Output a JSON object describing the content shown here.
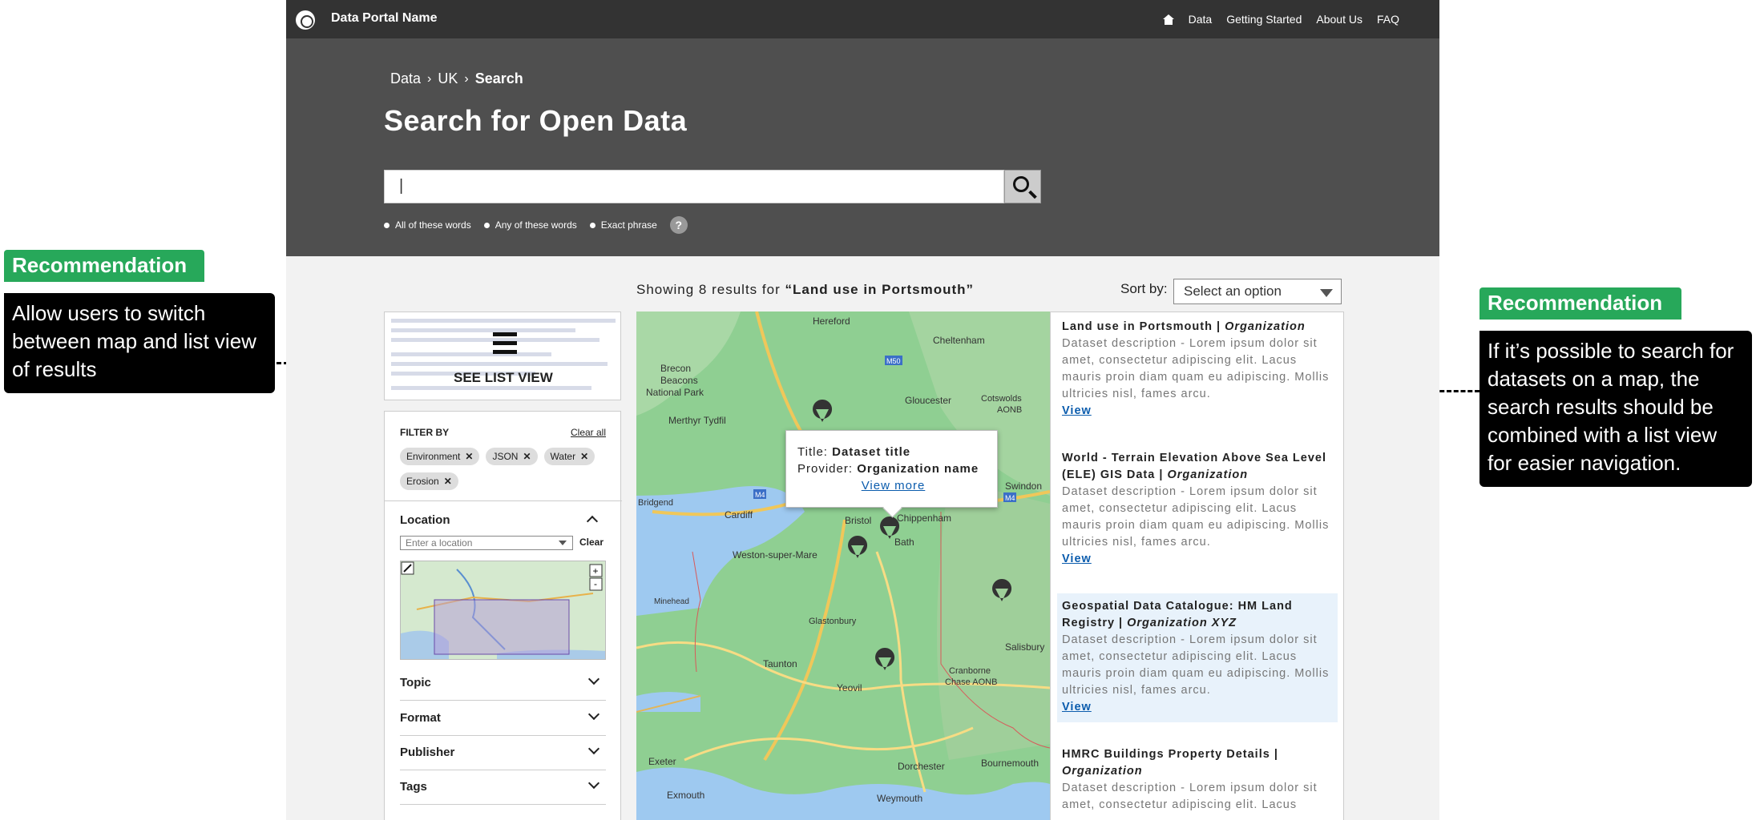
{
  "header": {
    "brand": "Data Portal Name",
    "nav": [
      "Data",
      "Getting Started",
      "About Us",
      "FAQ"
    ]
  },
  "hero": {
    "breadcrumb": [
      "Data",
      "UK",
      "Search"
    ],
    "title": "Search for Open Data",
    "search_value": "|",
    "search_options": [
      "All of these words",
      "Any of these words",
      "Exact phrase"
    ],
    "help": "?"
  },
  "results_header": {
    "prefix": "Showing 8 results for",
    "query": "“Land use in Portsmouth”",
    "sort_label": "Sort by:",
    "sort_value": "Select an option"
  },
  "list_view": {
    "label": "SEE LIST VIEW"
  },
  "filters": {
    "title": "FILTER BY",
    "clear_all": "Clear all",
    "tags": [
      "Environment",
      "JSON",
      "Water",
      "Erosion"
    ],
    "location": {
      "title": "Location",
      "placeholder": "Enter a location",
      "clear": "Clear"
    },
    "facets": [
      "Topic",
      "Format",
      "Publisher",
      "Tags"
    ]
  },
  "map": {
    "places": [
      "Hereford",
      "Brecon Beacons National Park",
      "Merthyr Tydfil",
      "Cheltenham",
      "Gloucester",
      "Cotswolds AONB",
      "Cardiff",
      "Bristol",
      "Bath",
      "Chippenham",
      "Swindon",
      "Weston-super-Mare",
      "Minehead",
      "Glastonbury",
      "Taunton",
      "Yeovil",
      "Salisbury",
      "Cranborne Chase AONB",
      "Exeter",
      "Dorchester",
      "Bournemouth",
      "Weymouth",
      "Exmouth",
      "Bridgend",
      "M50",
      "M4",
      "M5",
      "A4"
    ],
    "popup": {
      "title_label": "Title:",
      "title_value": "Dataset title",
      "provider_label": "Provider:",
      "provider_value": "Organization name",
      "view_more": "View more"
    }
  },
  "results": [
    {
      "title": "Land use in Portsmouth |",
      "org": "Organization",
      "desc": "Dataset description - Lorem ipsum dolor sit amet, consectetur adipiscing elit. Lacus mauris proin diam quam eu adipiscing. Mollis ultricies nisl, fames arcu.",
      "link": "View"
    },
    {
      "title": "World - Terrain Elevation Above Sea Level (ELE) GIS Data |",
      "org": "Organization",
      "desc": "Dataset description - Lorem ipsum dolor sit amet, consectetur adipiscing elit. Lacus mauris proin diam quam eu adipiscing. Mollis ultricies nisl, fames arcu.",
      "link": "View"
    },
    {
      "title": "Geospatial Data Catalogue: HM Land Registry |",
      "org": "Organization XYZ",
      "desc": "Dataset description - Lorem ipsum dolor sit amet, consectetur adipiscing elit. Lacus mauris proin diam quam eu adipiscing. Mollis ultricies nisl, fames arcu.",
      "link": "View"
    },
    {
      "title": "HMRC Buildings Property Details |",
      "org": "Organization",
      "desc": "Dataset description - Lorem ipsum dolor sit amet, consectetur adipiscing elit. Lacus",
      "link": ""
    }
  ],
  "annotations": {
    "left": {
      "tag": "Recommendation",
      "body": "Allow users to switch between map and list view of results"
    },
    "right": {
      "tag": "Recommendation",
      "body": "If it’s possible to search for datasets on a map, the search results should be combined with a list view for easier navigation."
    }
  },
  "colors": {
    "header": "#333333",
    "hero": "#4f4f4f",
    "recommendation": "#27a85a",
    "link": "#0b5cad",
    "highlight": "#e8f2fb"
  }
}
